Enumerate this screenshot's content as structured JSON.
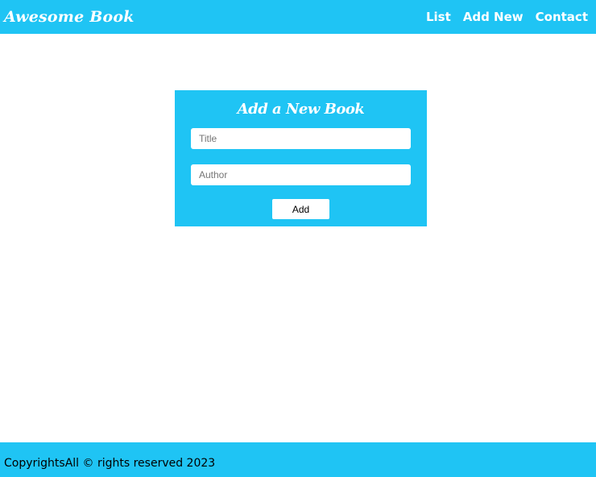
{
  "colors": {
    "accent": "#1fc4f4",
    "text_light": "#ffffff",
    "text_dark": "#000000"
  },
  "header": {
    "brand": "Awesome Book",
    "nav": [
      {
        "label": "List"
      },
      {
        "label": "Add New"
      },
      {
        "label": "Contact"
      }
    ]
  },
  "form": {
    "title": "Add a New Book",
    "title_input": {
      "placeholder": "Title",
      "value": ""
    },
    "author_input": {
      "placeholder": "Author",
      "value": ""
    },
    "submit_label": "Add"
  },
  "footer": {
    "text": "CopyrightsAll © rights reserved 2023"
  }
}
